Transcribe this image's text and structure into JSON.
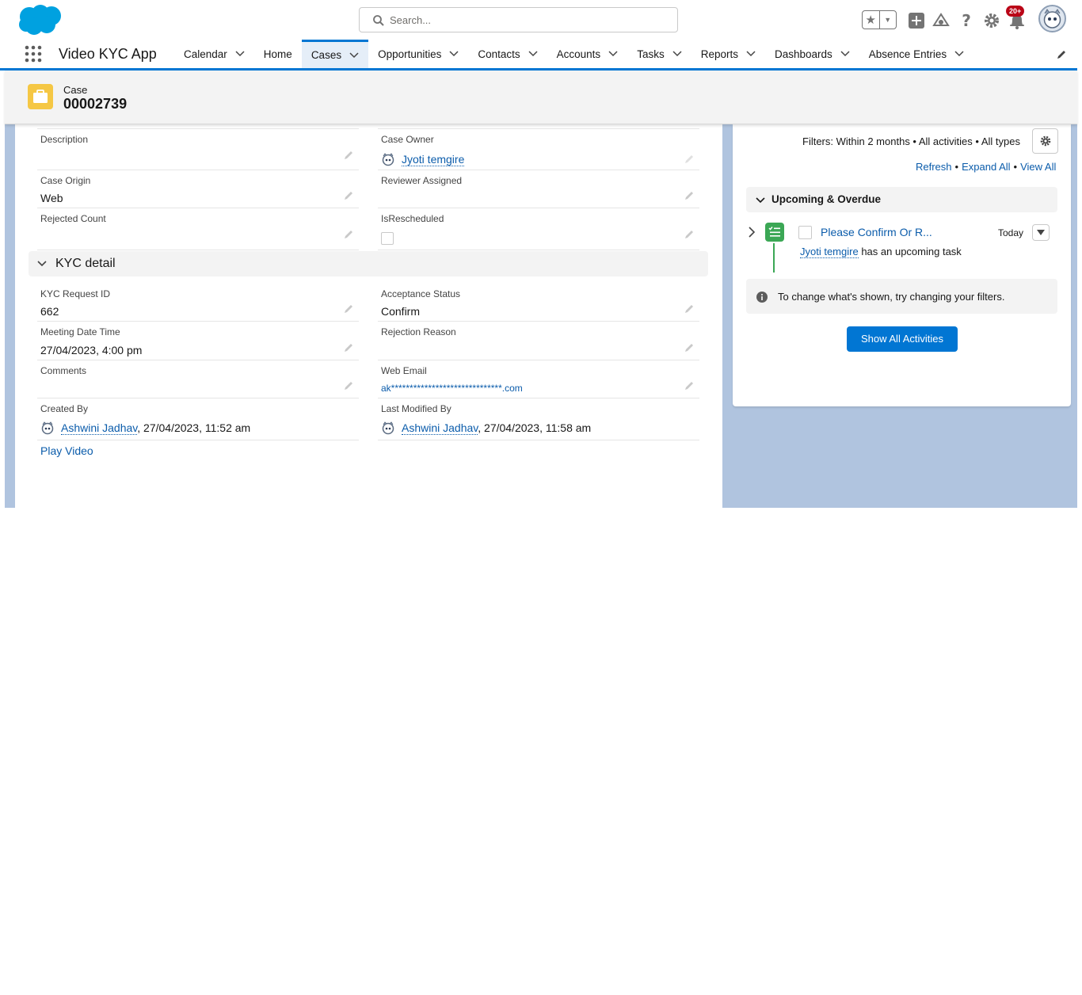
{
  "header": {
    "search_placeholder": "Search...",
    "notification_count": "20+",
    "icons": [
      "salesforce-logo",
      "search-icon",
      "star-icon",
      "add-icon",
      "trailhead-icon",
      "help-icon",
      "gear-icon",
      "bell-icon",
      "avatar"
    ]
  },
  "nav": {
    "app_name": "Video KYC App",
    "items": [
      {
        "label": "Calendar",
        "has_menu": true
      },
      {
        "label": "Home",
        "has_menu": false
      },
      {
        "label": "Cases",
        "has_menu": true,
        "active": true
      },
      {
        "label": "Opportunities",
        "has_menu": true
      },
      {
        "label": "Contacts",
        "has_menu": true
      },
      {
        "label": "Accounts",
        "has_menu": true
      },
      {
        "label": "Tasks",
        "has_menu": true
      },
      {
        "label": "Reports",
        "has_menu": true
      },
      {
        "label": "Dashboards",
        "has_menu": true
      },
      {
        "label": "Absence Entries",
        "has_menu": true
      }
    ]
  },
  "record": {
    "type": "Case",
    "number": "00002739"
  },
  "details": {
    "description_label": "Description",
    "description_value": "",
    "case_owner_label": "Case Owner",
    "case_owner_value": "Jyoti temgire",
    "case_origin_label": "Case Origin",
    "case_origin_value": "Web",
    "reviewer_label": "Reviewer Assigned",
    "reviewer_value": "",
    "rejected_count_label": "Rejected Count",
    "rejected_count_value": "",
    "is_rescheduled_label": "IsRescheduled",
    "is_rescheduled_value": false
  },
  "kyc_section": {
    "title": "KYC detail",
    "kyc_request_id_label": "KYC Request ID",
    "kyc_request_id_value": "662",
    "acceptance_status_label": "Acceptance Status",
    "acceptance_status_value": "Confirm",
    "meeting_label": "Meeting Date Time",
    "meeting_value": "27/04/2023, 4:00 pm",
    "rejection_reason_label": "Rejection Reason",
    "rejection_reason_value": "",
    "comments_label": "Comments",
    "comments_value": "",
    "web_email_label": "Web Email",
    "web_email_value": "ak******************************.com",
    "created_by_label": "Created By",
    "created_by_user": "Ashwini Jadhav",
    "created_by_date": ", 27/04/2023, 11:52 am",
    "last_modified_label": "Last Modified By",
    "last_modified_user": "Ashwini Jadhav",
    "last_modified_date": ", 27/04/2023, 11:58 am",
    "play_video": "Play Video"
  },
  "activity": {
    "filters": "Filters: Within 2 months • All activities • All types",
    "refresh": "Refresh",
    "expand_all": "Expand All",
    "view_all": "View All",
    "separator": "•",
    "upcoming_title": "Upcoming & Overdue",
    "task_title": "Please Confirm Or R...",
    "task_date": "Today",
    "task_user": "Jyoti temgire",
    "task_suffix": "has an upcoming task",
    "info_text": "To change what's shown, try changing your filters.",
    "show_all_button": "Show All Activities"
  },
  "colors": {
    "brand_blue": "#0176d3",
    "link": "#0b5cab",
    "case_icon": "#f5c744",
    "task_green": "#3ba755",
    "badge_red": "#ba0517",
    "background": "#b0c4df"
  }
}
